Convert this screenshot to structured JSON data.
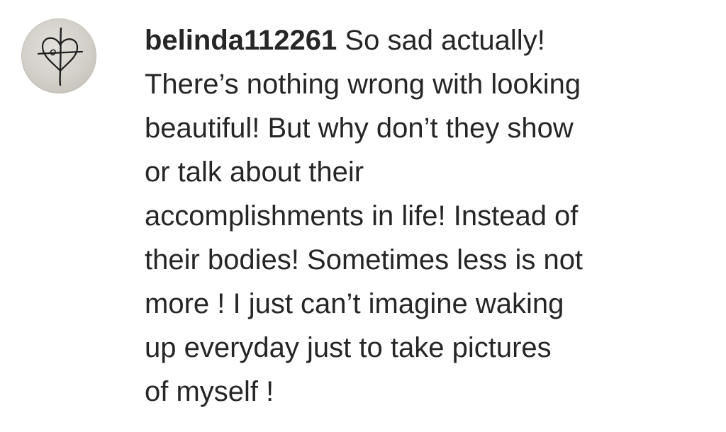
{
  "comment": {
    "username": "belinda112261",
    "lines": [
      "So sad actually!",
      "There’s nothing wrong with looking",
      "beautiful! But why don’t they show",
      "or talk about their",
      "accomplishments in life! Instead of",
      "their bodies! Sometimes less is not",
      "more ! I just can’t imagine waking",
      "up everyday just to take pictures",
      "of myself !"
    ]
  },
  "avatar": {
    "icon": "heart-cross-icon",
    "background_color": "#d2cec8",
    "stroke_color": "#1f1f1f"
  },
  "colors": {
    "text": "#262626",
    "background": "#ffffff"
  }
}
